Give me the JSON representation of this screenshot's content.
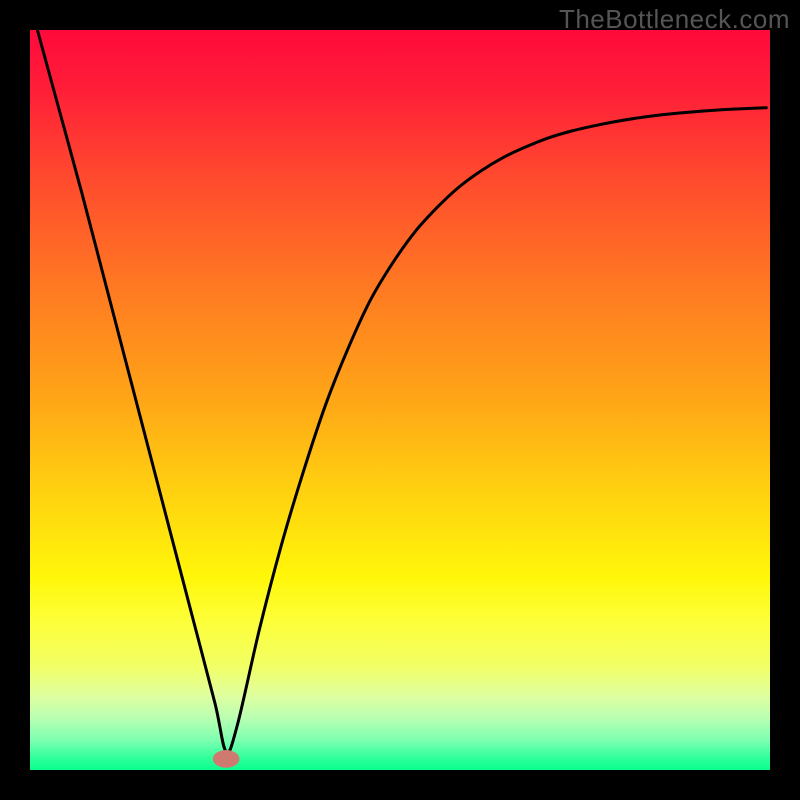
{
  "watermark": "TheBottleneck.com",
  "gradient_stops": [
    {
      "offset": 0.0,
      "color": "#ff0a3b"
    },
    {
      "offset": 0.08,
      "color": "#ff1e38"
    },
    {
      "offset": 0.2,
      "color": "#ff4a2e"
    },
    {
      "offset": 0.35,
      "color": "#ff7a22"
    },
    {
      "offset": 0.5,
      "color": "#ffa617"
    },
    {
      "offset": 0.62,
      "color": "#ffd010"
    },
    {
      "offset": 0.74,
      "color": "#fff70a"
    },
    {
      "offset": 0.8,
      "color": "#fdff3a"
    },
    {
      "offset": 0.86,
      "color": "#f2ff66"
    },
    {
      "offset": 0.9,
      "color": "#dfffa0"
    },
    {
      "offset": 0.93,
      "color": "#b9ffb2"
    },
    {
      "offset": 0.96,
      "color": "#7cffb0"
    },
    {
      "offset": 0.985,
      "color": "#2cff9a"
    },
    {
      "offset": 1.0,
      "color": "#0aff8f"
    }
  ],
  "chart_data": {
    "type": "line",
    "title": "",
    "xlabel": "",
    "ylabel": "",
    "xlim": [
      0,
      100
    ],
    "ylim": [
      0,
      100
    ],
    "series": [
      {
        "name": "curve",
        "x": [
          1,
          4,
          7,
          10,
          13,
          16,
          19,
          22,
          25,
          26.5,
          28,
          31,
          34,
          37,
          40,
          43,
          46,
          49,
          52,
          55,
          58,
          61,
          64,
          67,
          70,
          73,
          76,
          79,
          82,
          85,
          88,
          91,
          94,
          97,
          99.5
        ],
        "y": [
          100,
          89,
          78,
          66.5,
          55,
          43.5,
          32,
          20.5,
          9,
          2.5,
          6,
          19,
          30.5,
          40.5,
          49.5,
          57,
          63.5,
          68.5,
          72.7,
          76,
          78.8,
          81,
          82.8,
          84.2,
          85.4,
          86.3,
          87,
          87.6,
          88.1,
          88.5,
          88.8,
          89.05,
          89.25,
          89.4,
          89.5
        ]
      }
    ],
    "marker": {
      "x": 26.5,
      "y": 1.5,
      "rx": 1.8,
      "ry": 1.2
    }
  }
}
